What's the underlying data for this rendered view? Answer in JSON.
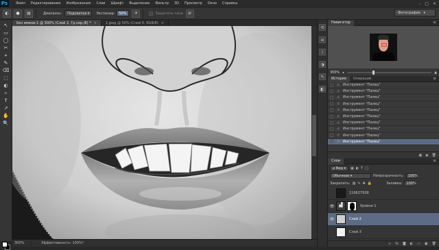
{
  "menubar": {
    "logo": "Ps",
    "items": [
      "Файл",
      "Редактирование",
      "Изображение",
      "Слои",
      "Шрифт",
      "Выделение",
      "Фильтр",
      "3D",
      "Просмотр",
      "Окно",
      "Справка"
    ],
    "controls": [
      "–",
      "□",
      "✕"
    ]
  },
  "options_bar": {
    "range_label": "Диапазон:",
    "range_value": "Подсветка",
    "exposure_label": "Экспонир:",
    "exposure_value": "50%",
    "protect_tones_label": "Защитить тона",
    "workspace": "Фотография"
  },
  "tools": [
    "↖",
    "▭",
    "◯",
    "✂",
    "⌖",
    "✎",
    "⌫",
    "⬚",
    "◐",
    "⌕",
    "T",
    "↗",
    "✋",
    "🔍"
  ],
  "document_tabs": [
    {
      "label": "Без имени-1 @ 300% (Слой 2, Гр.сер./8) *",
      "active": true
    },
    {
      "label": "1.jpeg @ 50% (Слой 0, RGB/8)",
      "active": false
    }
  ],
  "status": {
    "zoom": "300%",
    "info": "Эффективность: 100%*"
  },
  "navigator": {
    "tab": "Навигатор",
    "zoom": "300%"
  },
  "history": {
    "tabs": [
      "История",
      "Операции"
    ],
    "items": [
      "Инструмент \"Палец\"",
      "Инструмент \"Палец\"",
      "Инструмент \"Палец\"",
      "Инструмент \"Палец\"",
      "Инструмент \"Палец\"",
      "Инструмент \"Палец\"",
      "Инструмент \"Палец\"",
      "Инструмент \"Палец\"",
      "Инструмент \"Палец\"",
      "Инструмент \"Палец\""
    ],
    "selected_index": 9
  },
  "layers": {
    "tab": "Слои",
    "filter": "Вид",
    "blend_mode": "Обычные",
    "opacity_label": "Непрозрачность:",
    "opacity": "100%",
    "lock_label": "Закрепить:",
    "fill_label": "Заливка:",
    "fill": "100%",
    "items": [
      {
        "name": "116627938",
        "visible": false,
        "type": "photo"
      },
      {
        "name": "Уровни 1",
        "visible": true,
        "type": "adjustment"
      },
      {
        "name": "Слой 2",
        "visible": true,
        "type": "gray",
        "selected": true
      },
      {
        "name": "Слой 3",
        "visible": false,
        "type": "white"
      }
    ]
  },
  "colors": {
    "accent": "#5d6b86",
    "panel": "#353535",
    "ps_blue": "#31a8ff"
  }
}
